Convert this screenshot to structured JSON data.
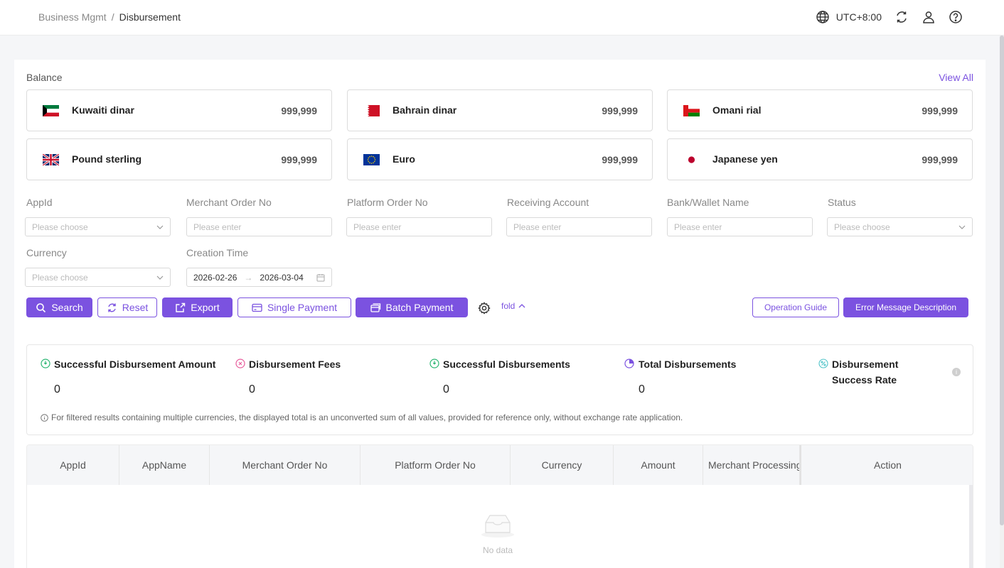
{
  "breadcrumb": {
    "parent": "Business Mgmt",
    "separator": "/",
    "current": "Disbursement"
  },
  "header": {
    "timezone": "UTC+8:00"
  },
  "balance": {
    "title": "Balance",
    "view_all": "View All",
    "cards": [
      {
        "name": "Kuwaiti dinar",
        "amount": "999,999",
        "flag": "kuwait-flag-icon"
      },
      {
        "name": "Bahrain dinar",
        "amount": "999,999",
        "flag": "bahrain-flag-icon"
      },
      {
        "name": "Omani rial",
        "amount": "999,999",
        "flag": "oman-flag-icon"
      },
      {
        "name": "Pound sterling",
        "amount": "999,999",
        "flag": "uk-flag-icon"
      },
      {
        "name": "Euro",
        "amount": "999,999",
        "flag": "eu-flag-icon"
      },
      {
        "name": "Japanese yen",
        "amount": "999,999",
        "flag": "japan-flag-icon"
      }
    ]
  },
  "filters": {
    "appid": {
      "label": "AppId",
      "placeholder": "Please choose"
    },
    "merchant_order_no": {
      "label": "Merchant Order No",
      "placeholder": "Please enter"
    },
    "platform_order_no": {
      "label": "Platform Order No",
      "placeholder": "Please enter"
    },
    "receiving_account": {
      "label": "Receiving Account",
      "placeholder": "Please enter"
    },
    "bank_wallet_name": {
      "label": "Bank/Wallet Name",
      "placeholder": "Please enter"
    },
    "status": {
      "label": "Status",
      "placeholder": "Please choose"
    },
    "currency": {
      "label": "Currency",
      "placeholder": "Please choose"
    },
    "creation_time": {
      "label": "Creation Time",
      "start": "2026-02-26",
      "arrow": "→",
      "end": "2026-03-04"
    }
  },
  "actions": {
    "search": "Search",
    "reset": "Reset",
    "export": "Export",
    "single_payment": "Single Payment",
    "batch_payment": "Batch Payment",
    "fold": "fold",
    "operation_guide": "Operation Guide",
    "error_message_description": "Error Message Description"
  },
  "stats": {
    "successful_amount": {
      "label": "Successful Disbursement Amount",
      "value": "0"
    },
    "fees": {
      "label": "Disbursement Fees",
      "value": "0"
    },
    "successful_count": {
      "label": "Successful Disbursements",
      "value": "0"
    },
    "total": {
      "label": "Total Disbursements",
      "value": "0"
    },
    "success_rate": {
      "label": "Disbursement Success Rate"
    },
    "note": "For filtered results containing multiple currencies, the displayed total is an unconverted sum of all values, provided for reference only, without exchange rate application."
  },
  "table": {
    "columns": [
      "AppId",
      "AppName",
      "Merchant Order No",
      "Platform Order No",
      "Currency",
      "Amount",
      "Merchant Processing",
      "Action"
    ],
    "empty_text": "No data"
  },
  "colors": {
    "accent": "#7b52e0",
    "success": "#2bb673",
    "warning": "#e85d9c"
  }
}
